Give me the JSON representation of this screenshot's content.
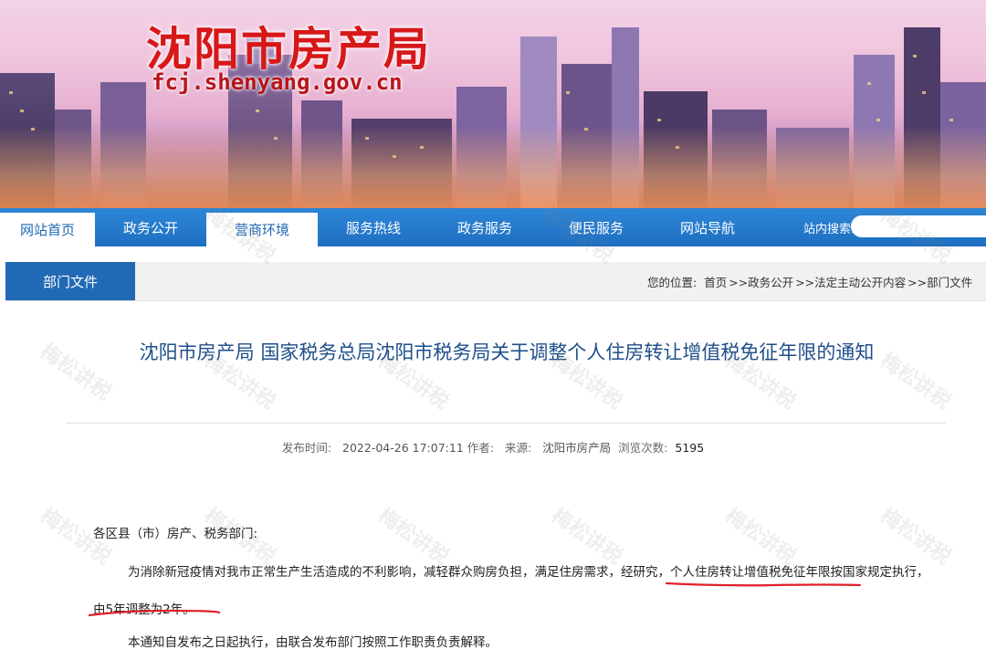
{
  "banner": {
    "title": "沈阳市房产局",
    "url": "fcj.shenyang.gov.cn"
  },
  "nav": {
    "items": [
      {
        "label": "网站首页"
      },
      {
        "label": "政务公开"
      },
      {
        "label": "营商环境"
      },
      {
        "label": "服务热线"
      },
      {
        "label": "政务服务"
      },
      {
        "label": "便民服务"
      },
      {
        "label": "网站导航"
      }
    ],
    "active_index": 2,
    "search_label": "站内搜索:",
    "search_value": ""
  },
  "section": {
    "tab": "部门文件",
    "breadcrumb": {
      "prefix": "您的位置:",
      "items": [
        "首页",
        ">>政务公开",
        ">>法定主动公开内容",
        ">>部门文件"
      ]
    }
  },
  "article": {
    "title": "沈阳市房产局 国家税务总局沈阳市税务局关于调整个人住房转让增值税免征年限的通知",
    "meta": {
      "time_label": "发布时间:",
      "time_value": "2022-04-26 17:07:11",
      "author_label": "作者:",
      "source_label": "来源:",
      "source_value": "沈阳市房产局",
      "views_label": "浏览次数:",
      "views_value": "5195"
    },
    "greeting": "各区县（市）房产、税务部门:",
    "para1_a": "为消除新冠疫情对我市正常生产生活造成的不利影响，减轻群众购房负担，满足住房需求，经研究，",
    "para1_b": "个人住房转让增值税免征年限按国家规定执行，",
    "para1_c": "由5年调整为2年。",
    "para2": "本通知自发布之日起执行，由联合发布部门按照工作职责负责解释。"
  },
  "watermark": {
    "text": "梅松讲税"
  },
  "colors": {
    "nav_blue": "#1e6fc1",
    "tab_blue": "#2169b4",
    "title_red": "#d71718",
    "article_title": "#1f4f8a",
    "underline_red": "#e0202a"
  }
}
